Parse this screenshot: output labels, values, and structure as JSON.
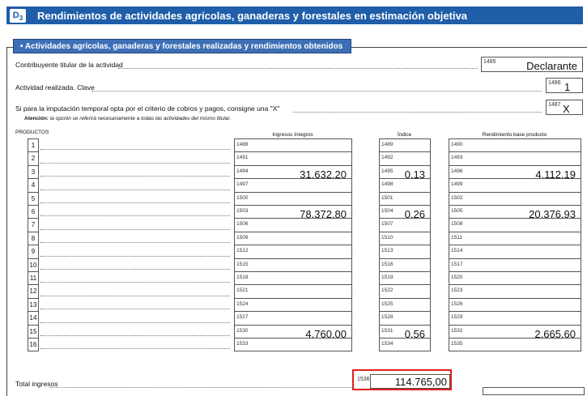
{
  "header": {
    "badge": "D",
    "badge_sub": "3",
    "title": "Rendimientos de actividades agrícolas, ganaderas y forestales en estimación objetiva"
  },
  "section": {
    "title": "• Actividades agrícolas, ganaderas y forestales realizadas y rendimientos obtenidos"
  },
  "fields": {
    "contribuyente": {
      "label": "Contribuyente titular de la actividad",
      "code": "1485",
      "value": "Declarante"
    },
    "actividad": {
      "label": "Actividad realizada. Clave",
      "code": "1486",
      "value": "1"
    },
    "imputacion": {
      "label": "Si para la imputación temporal opta por el criterio de cobros y pagos, consigne una \"X\"",
      "code": "1487",
      "value": "X"
    },
    "atencion_label": "Atención:",
    "atencion_text": "la opción se referirá necesariamente a todas las actividades del mismo titular."
  },
  "table": {
    "headers": {
      "productos": "PRODUCTOS",
      "ingresos": "Ingresos íntegros",
      "indice": "Índice",
      "rendimiento": "Rendimiento base producto"
    },
    "rows": [
      {
        "n": "1",
        "c1": "1488",
        "v1": "",
        "c2": "1489",
        "v2": "",
        "c3": "1490",
        "v3": ""
      },
      {
        "n": "2",
        "c1": "1491",
        "v1": "",
        "c2": "1492",
        "v2": "",
        "c3": "1493",
        "v3": ""
      },
      {
        "n": "3",
        "c1": "1494",
        "v1": "31.632,20",
        "c2": "1495",
        "v2": "0,13",
        "c3": "1496",
        "v3": "4.112,19"
      },
      {
        "n": "4",
        "c1": "1497",
        "v1": "",
        "c2": "1498",
        "v2": "",
        "c3": "1499",
        "v3": ""
      },
      {
        "n": "5",
        "c1": "1500",
        "v1": "",
        "c2": "1501",
        "v2": "",
        "c3": "1502",
        "v3": ""
      },
      {
        "n": "6",
        "c1": "1503",
        "v1": "78.372,80",
        "c2": "1504",
        "v2": "0,26",
        "c3": "1505",
        "v3": "20.376,93"
      },
      {
        "n": "7",
        "c1": "1506",
        "v1": "",
        "c2": "1507",
        "v2": "",
        "c3": "1508",
        "v3": ""
      },
      {
        "n": "8",
        "c1": "1509",
        "v1": "",
        "c2": "1510",
        "v2": "",
        "c3": "1511",
        "v3": ""
      },
      {
        "n": "9",
        "c1": "1512",
        "v1": "",
        "c2": "1513",
        "v2": "",
        "c3": "1514",
        "v3": ""
      },
      {
        "n": "10",
        "c1": "1515",
        "v1": "",
        "c2": "1516",
        "v2": "",
        "c3": "1517",
        "v3": ""
      },
      {
        "n": "11",
        "c1": "1518",
        "v1": "",
        "c2": "1519",
        "v2": "",
        "c3": "1520",
        "v3": ""
      },
      {
        "n": "12",
        "c1": "1521",
        "v1": "",
        "c2": "1522",
        "v2": "",
        "c3": "1523",
        "v3": ""
      },
      {
        "n": "13",
        "c1": "1524",
        "v1": "",
        "c2": "1525",
        "v2": "",
        "c3": "1526",
        "v3": ""
      },
      {
        "n": "14",
        "c1": "1527",
        "v1": "",
        "c2": "1528",
        "v2": "",
        "c3": "1529",
        "v3": ""
      },
      {
        "n": "15",
        "c1": "1530",
        "v1": "4.760,00",
        "c2": "1531",
        "v2": "0,56",
        "c3": "1532",
        "v3": "2.665,60"
      },
      {
        "n": "16",
        "c1": "1533",
        "v1": "",
        "c2": "1534",
        "v2": "",
        "c3": "1535",
        "v3": ""
      }
    ]
  },
  "total": {
    "label": "Total ingresos",
    "code": "1536",
    "value": "114.765,00"
  },
  "colors": {
    "header_blue": "#1f5ea8",
    "section_blue": "#3d6fb6",
    "highlight_red": "#e0201b"
  }
}
